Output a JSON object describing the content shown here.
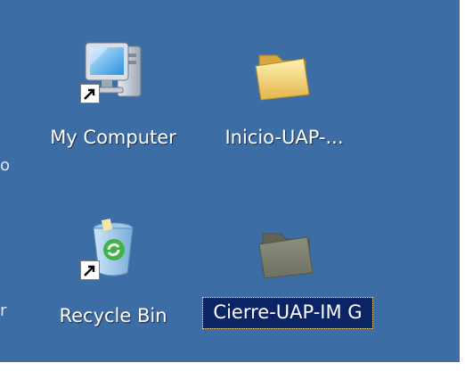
{
  "desktop": {
    "icons": [
      {
        "label": "My Computer",
        "icon": "my-computer-icon",
        "shortcut": true
      },
      {
        "label": "Inicio-UAP-...",
        "icon": "folder-icon"
      },
      {
        "label": "Recycle Bin",
        "icon": "recycle-bin-icon",
        "shortcut": true
      },
      {
        "label": "Cierre-UAP-IM G",
        "icon": "folder-icon",
        "selected": true
      }
    ]
  },
  "colors": {
    "desktop_background": "#3c6ea5",
    "selection_background": "#0b2466",
    "label_text": "#ffffff"
  }
}
